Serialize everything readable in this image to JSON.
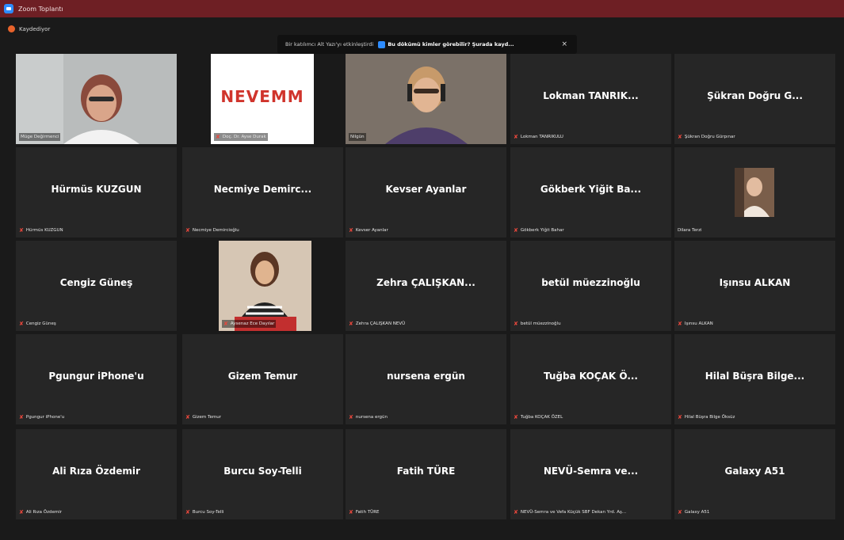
{
  "window": {
    "title": "Zoom Toplantı"
  },
  "recording": {
    "label": "Kaydediyor"
  },
  "captions": {
    "text": "Bir katılımcı Alt Yazı'yı etkinleştirdi",
    "link": "Bu dökümü kimler görebilir? Şurada kayd...",
    "close": "×"
  },
  "tiles": [
    {
      "big": "",
      "label": "Müge Değirmenci",
      "video": true,
      "muted": false
    },
    {
      "big": "",
      "label": "Doç. Dr. Ayse Durak",
      "video": true,
      "logo": "NEVEMM",
      "muted": true
    },
    {
      "big": "",
      "label": "Nilgün",
      "video": true,
      "muted": false,
      "active": true
    },
    {
      "big": "Lokman TANRIK...",
      "label": "Lokman TANRIKULU",
      "muted": true
    },
    {
      "big": "Şükran Doğru G...",
      "label": "Şükran Doğru Gürpınar",
      "muted": true
    },
    {
      "big": "Hürmüs KUZGUN",
      "label": "Hürmüs KUZGUN",
      "muted": true
    },
    {
      "big": "Necmiye Demirc...",
      "label": "Necmiye Demircioğlu",
      "muted": true
    },
    {
      "big": "Kevser Ayanlar",
      "label": "Kevser Ayanlar",
      "muted": true
    },
    {
      "big": "Gökberk Yiğit Ba...",
      "label": "Gökberk Yiğit Bahar",
      "muted": true
    },
    {
      "big": "",
      "label": "Dilara Terzi",
      "photo": true,
      "muted": false
    },
    {
      "big": "Cengiz Güneş",
      "label": "Cengiz Güneş",
      "muted": true
    },
    {
      "big": "",
      "label": "Aysenaz Ece Dayılar",
      "video": true,
      "muted": true
    },
    {
      "big": "Zehra  ÇALIŞKAN...",
      "label": "Zehra ÇALIŞKAN NEVÜ",
      "muted": true
    },
    {
      "big": "betül müezzinoğlu",
      "label": "betül müezzinoğlu",
      "muted": true
    },
    {
      "big": "Işınsu ALKAN",
      "label": "Işınsu ALKAN",
      "muted": true
    },
    {
      "big": "Pgungur iPhone'u",
      "label": "Pgungur iPhone'u",
      "muted": true
    },
    {
      "big": "Gizem Temur",
      "label": "Gizem Temur",
      "muted": true
    },
    {
      "big": "nursena ergün",
      "label": "nursena ergün",
      "muted": true
    },
    {
      "big": "Tuğba KOÇAK Ö...",
      "label": "Tuğba KOÇAK ÖZEL",
      "muted": true
    },
    {
      "big": "Hilal Büşra Bilge...",
      "label": "Hilal Büşra Bilge Öksüz",
      "muted": true
    },
    {
      "big": "Ali Rıza Özdemir",
      "label": "Ali Rıza Özdemir",
      "muted": true
    },
    {
      "big": "Burcu Soy-Telli",
      "label": "Burcu Soy-Telli",
      "muted": true
    },
    {
      "big": "Fatih TÜRE",
      "label": "Fatih TÜRE",
      "muted": true
    },
    {
      "big": "NEVÜ-Semra  ve...",
      "label": "NEVÜ-Semra ve Vefa Küçük SBF Dekan Yrd. Aş...",
      "muted": true
    },
    {
      "big": "Galaxy A51",
      "label": "Galaxy A51",
      "muted": true
    }
  ],
  "icons": {
    "muted": "microphone-muted-icon",
    "recording": "recording-dot-icon"
  },
  "colors": {
    "titlebar": "#6e1f24",
    "tile": "#262626",
    "muted": "#e8473c",
    "active_border": "#c8d24a",
    "logo_red": "#d0342c"
  }
}
